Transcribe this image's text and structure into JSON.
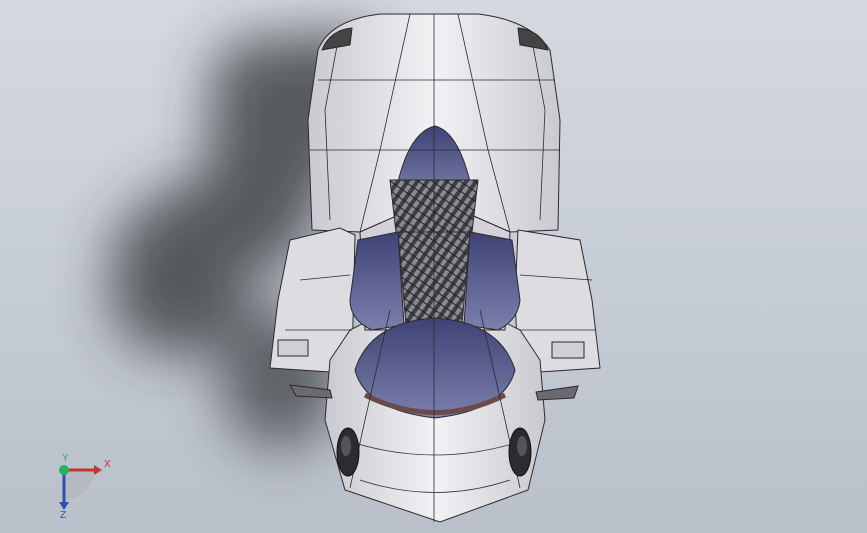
{
  "viewport": {
    "background_top": "#d4d9e0",
    "background_bottom": "#b9c0ca",
    "model": {
      "body_color": "#e6e6ea",
      "edge_color": "#2a2a2e",
      "glass_color": "#5c6291",
      "carbon_color": "#4a4a4f",
      "shadow_color": "#3b3d40"
    }
  },
  "triad": {
    "x_label": "X",
    "y_label": "Y",
    "z_label": "Z",
    "x_color": "#c0392b",
    "y_color": "#27ae60",
    "z_color": "#2e4fb5"
  }
}
